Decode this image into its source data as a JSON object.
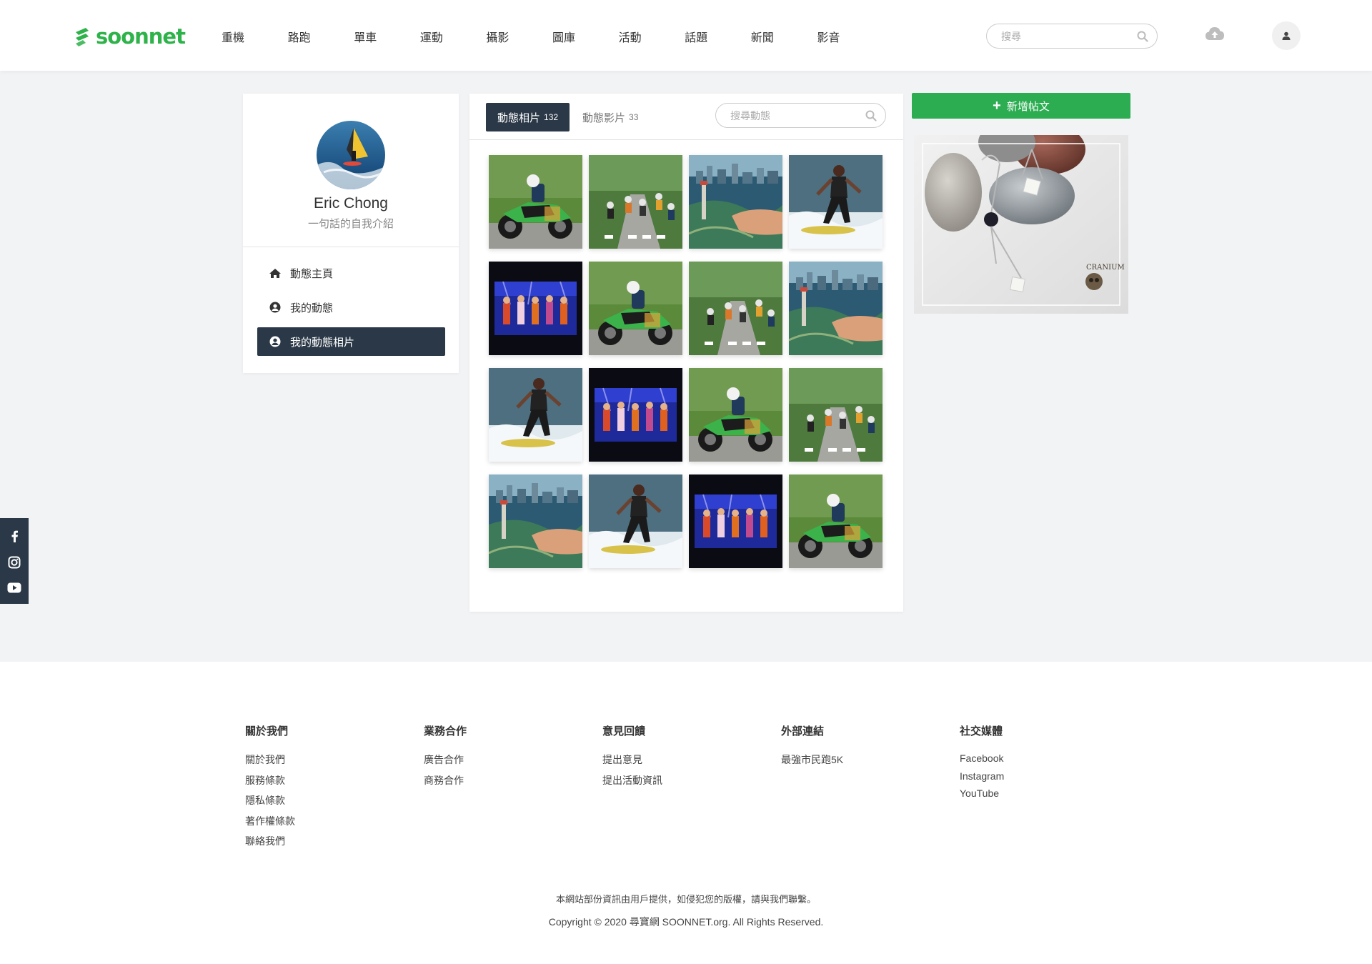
{
  "brand": {
    "name": "soonnet",
    "color": "#2eb24a"
  },
  "nav": [
    "重機",
    "路跑",
    "單車",
    "運動",
    "攝影",
    "圖庫",
    "活動",
    "話題",
    "新聞",
    "影音"
  ],
  "header_search": {
    "placeholder": "搜尋",
    "icon": "search-icon"
  },
  "header_icons": {
    "upload": "cloud-upload-icon",
    "user": "user-icon"
  },
  "profile": {
    "name": "Eric Chong",
    "bio": "一句話的自我介紹",
    "menu": [
      {
        "label": "動態主頁",
        "icon": "home-icon",
        "active": false
      },
      {
        "label": "我的動態",
        "icon": "user-circle-icon",
        "active": false
      },
      {
        "label": "我的動態相片",
        "icon": "user-circle-icon",
        "active": true
      }
    ]
  },
  "tabs": {
    "photos": {
      "label": "動態相片",
      "count": "132"
    },
    "videos": {
      "label": "動態影片",
      "count": "33"
    }
  },
  "post_search": {
    "placeholder": "搜尋動態"
  },
  "photos": [
    "motorcycle",
    "cycling",
    "city",
    "surf",
    "concert",
    "motorcycle",
    "cycling",
    "city",
    "surf",
    "concert",
    "motorcycle",
    "cycling",
    "city",
    "surf",
    "concert",
    "motorcycle"
  ],
  "new_post": {
    "label": "新增帖文"
  },
  "ad": {
    "watermark": "CRANIUM"
  },
  "social": [
    "facebook-icon",
    "instagram-icon",
    "youtube-icon"
  ],
  "footer": {
    "columns": [
      {
        "title": "關於我們",
        "links": [
          "關於我們",
          "服務條款",
          "隱私條款",
          "著作權條款",
          "聯絡我們"
        ]
      },
      {
        "title": "業務合作",
        "links": [
          "廣告合作",
          "商務合作"
        ]
      },
      {
        "title": "意見回饋",
        "links": [
          "提出意見",
          "提出活動資訊"
        ]
      },
      {
        "title": "外部連結",
        "links": [
          "最強市民跑5K"
        ]
      },
      {
        "title": "社交媒體",
        "links": [
          "Facebook",
          "Instagram",
          "YouTube"
        ]
      }
    ],
    "note": "本網站部份資訊由用戶提供，如侵犯您的版權，請與我們聯繫。",
    "copyright": "Copyright © 2020 尋寶網 SOONNET.org. All Rights Reserved."
  },
  "colors": {
    "dark": "#2b3847",
    "accent": "#2cad52",
    "background": "#f2f3f5"
  }
}
